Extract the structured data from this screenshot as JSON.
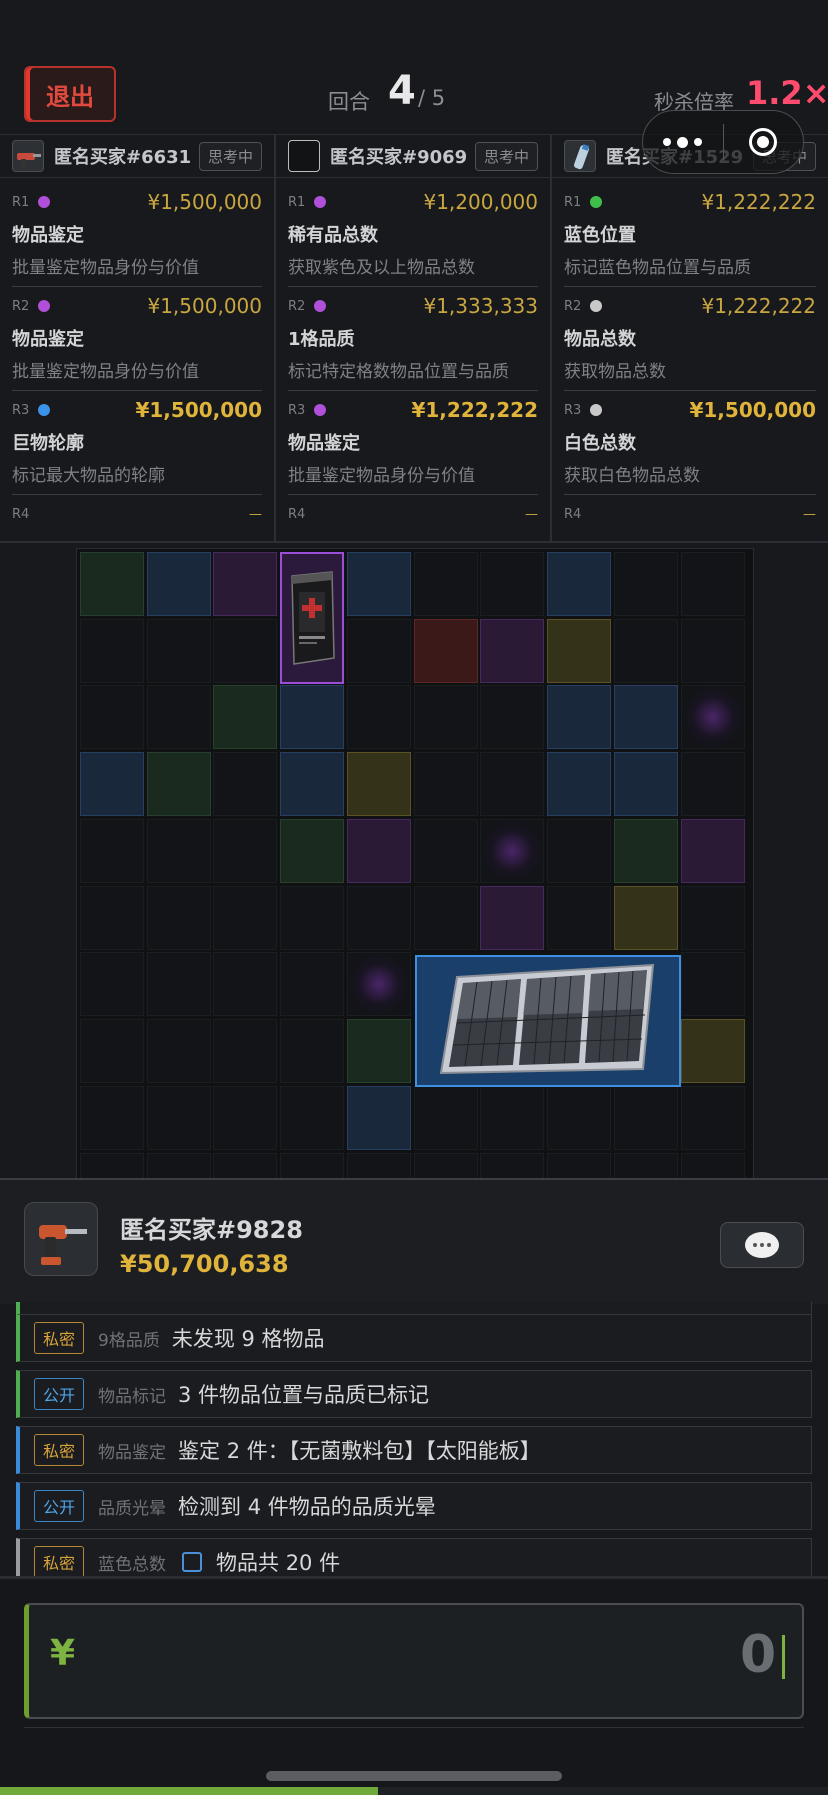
{
  "header": {
    "exit_label": "退出",
    "round_label": "回合",
    "round_current": "4",
    "round_total": "/ 5",
    "rate_label": "秒杀倍率",
    "rate_value": "1.2×"
  },
  "colors": {
    "purple": "#b04fd8",
    "blue": "#3b93e8",
    "green": "#3fbf4a",
    "white": "#c9c9c9",
    "gold": "#e0b43a",
    "red_accent": "#ff4b6e"
  },
  "buyers": [
    {
      "name": "匿名买家#6631",
      "status": "思考中",
      "avatar_icon": "nail-gun-icon",
      "rounds": [
        {
          "idx": "R1",
          "dot": "purple",
          "price": "¥1,500,000",
          "title": "物品鉴定",
          "desc": "批量鉴定物品身份与价值"
        },
        {
          "idx": "R2",
          "dot": "purple",
          "price": "¥1,500,000",
          "title": "物品鉴定",
          "desc": "批量鉴定物品身份与价值"
        },
        {
          "idx": "R3",
          "dot": "blue",
          "price": "¥1,500,000",
          "title": "巨物轮廓",
          "desc": "标记最大物品的轮廓"
        }
      ],
      "r4_idx": "R4",
      "r4_value": "—"
    },
    {
      "name": "匿名买家#9069",
      "status": "思考中",
      "avatar_icon": "blank-avatar-icon",
      "rounds": [
        {
          "idx": "R1",
          "dot": "purple",
          "price": "¥1,200,000",
          "title": "稀有品总数",
          "desc": "获取紫色及以上物品总数"
        },
        {
          "idx": "R2",
          "dot": "purple",
          "price": "¥1,333,333",
          "title": "1格品质",
          "desc": "标记特定格数物品位置与品质"
        },
        {
          "idx": "R3",
          "dot": "purple",
          "price": "¥1,222,222",
          "title": "物品鉴定",
          "desc": "批量鉴定物品身份与价值"
        }
      ],
      "r4_idx": "R4",
      "r4_value": "—"
    },
    {
      "name": "匿名买家#1529",
      "status": "思考中",
      "avatar_icon": "spray-bottle-icon",
      "rounds": [
        {
          "idx": "R1",
          "dot": "green",
          "price": "¥1,222,222",
          "title": "蓝色位置",
          "desc": "标记蓝色物品位置与品质"
        },
        {
          "idx": "R2",
          "dot": "white",
          "price": "¥1,222,222",
          "title": "物品总数",
          "desc": "获取物品总数"
        },
        {
          "idx": "R3",
          "dot": "white",
          "price": "¥1,500,000",
          "title": "白色总数",
          "desc": "获取白色物品总数"
        }
      ],
      "r4_idx": "R4",
      "r4_value": "—"
    }
  ],
  "grid": {
    "items": [
      {
        "name": "无菌敷料包",
        "quality": "purple"
      },
      {
        "name": "太阳能板",
        "quality": "blue"
      }
    ]
  },
  "player": {
    "name": "匿名买家#9828",
    "money": "¥50,700,638",
    "avatar_icon": "drill-icon"
  },
  "log": [
    {
      "tag": "私密",
      "kind": "9格品质",
      "msg": "未发现 9 格物品",
      "bar": "green"
    },
    {
      "tag": "公开",
      "kind": "物品标记",
      "msg": "3 件物品位置与品质已标记",
      "bar": "green"
    },
    {
      "tag": "私密",
      "kind": "物品鉴定",
      "msg": "鉴定 2 件：【无菌敷料包】【太阳能板】",
      "bar": "blue"
    },
    {
      "tag": "公开",
      "kind": "品质光晕",
      "msg": "检测到 4 件物品的品质光晕",
      "bar": "blue"
    },
    {
      "tag": "私密",
      "kind": "蓝色总数",
      "msg": "物品共 20 件",
      "bar": "gray"
    }
  ],
  "bid": {
    "currency": "¥",
    "value": "0"
  }
}
